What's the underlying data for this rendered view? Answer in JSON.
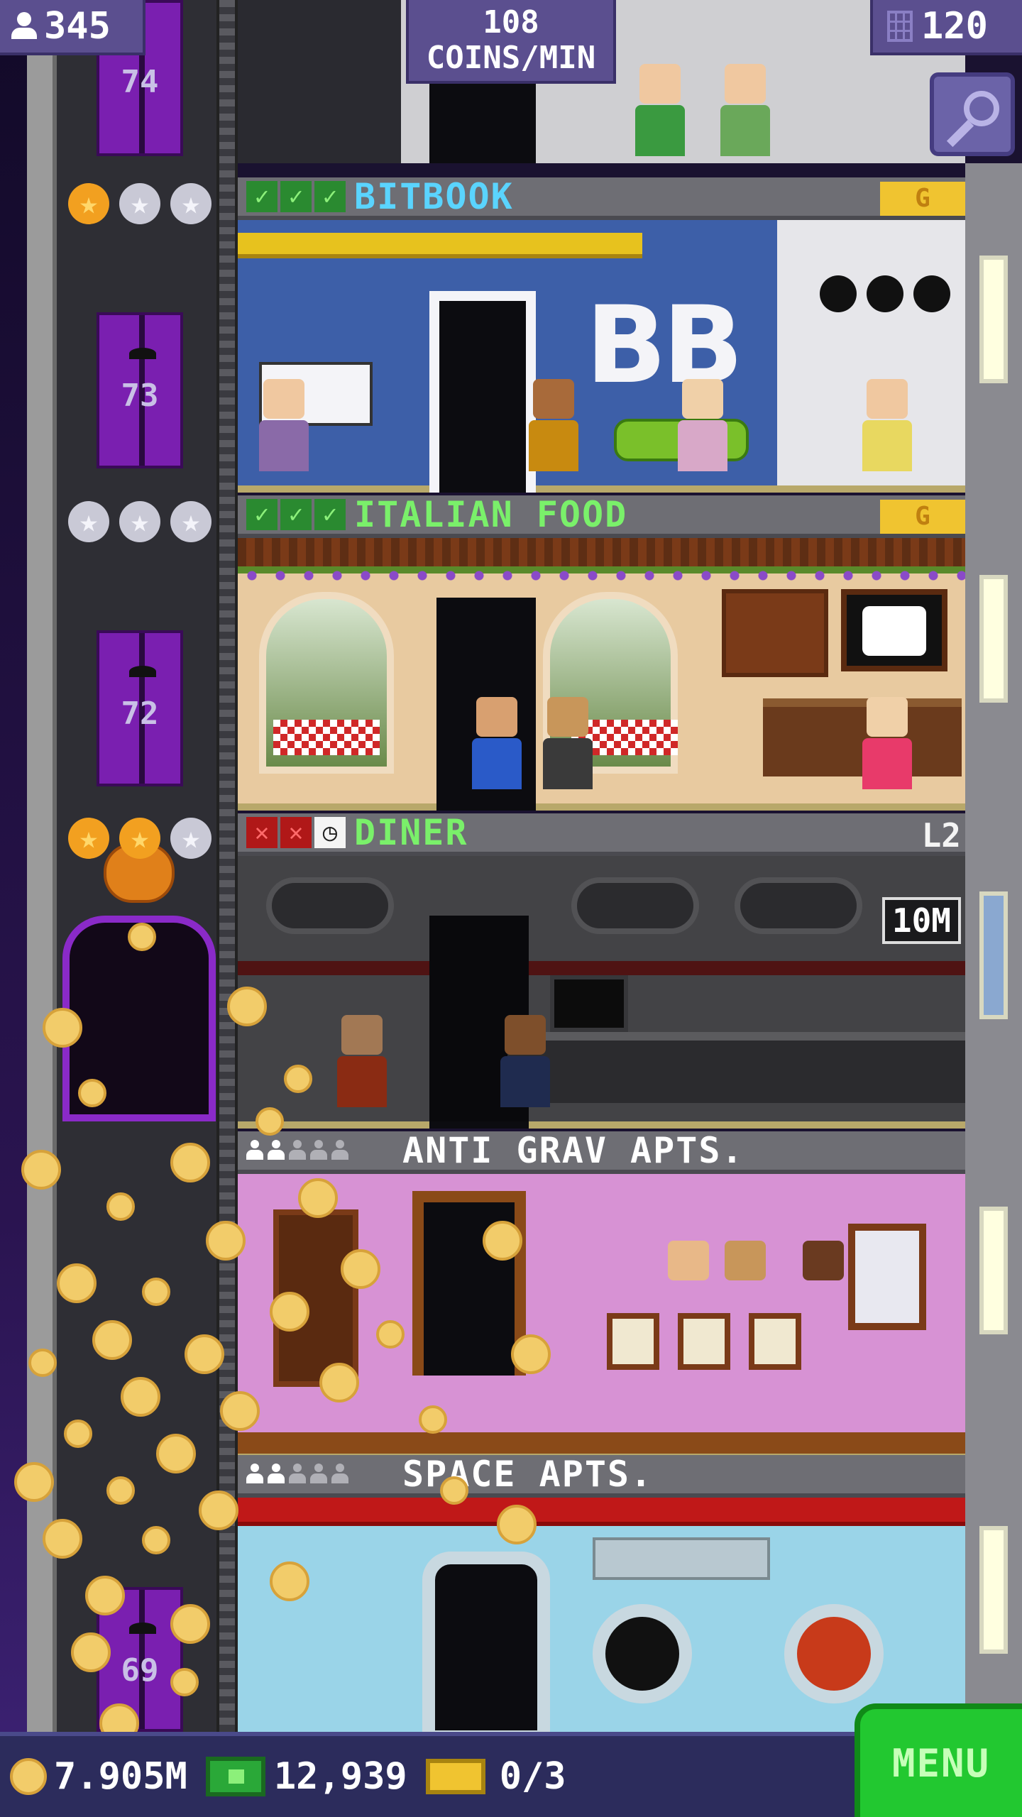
{
  "hud": {
    "population": "345",
    "coin_rate_value": "108",
    "coin_rate_unit": "COINS/MIN",
    "floors": "120"
  },
  "elevator": {
    "floor_numbers": [
      "74",
      "73",
      "72",
      "69"
    ]
  },
  "floors": [
    {
      "name": "BITBOOK",
      "status_icons": [
        "check",
        "check",
        "check"
      ],
      "badge": "G",
      "stars": [
        "gold",
        "silver",
        "silver"
      ]
    },
    {
      "name": "ITALIAN FOOD",
      "status_icons": [
        "check",
        "check",
        "check"
      ],
      "badge": "G",
      "stars": [
        "silver",
        "silver",
        "silver"
      ]
    },
    {
      "name": "DINER",
      "status_icons": [
        "x",
        "x",
        "clock"
      ],
      "level": "L2",
      "timer": "10M",
      "stars": [
        "gold",
        "gold",
        "silver"
      ]
    },
    {
      "name": "ANTI GRAV APTS.",
      "residents": 5,
      "residents_active": 2
    },
    {
      "name": "SPACE APTS.",
      "residents": 5,
      "residents_active": 2
    }
  ],
  "bottom_bar": {
    "coins": "7.905M",
    "bux": "12,939",
    "tickets": "0/3",
    "menu_label": "MENU"
  },
  "colors": {
    "elevator_door": "#7a1fb0",
    "menu_button": "#22c830",
    "hud_pill": "#5b4f8f",
    "coin": "#f2cc6a"
  },
  "icons": {
    "population": "person-icon",
    "floors": "building-icon",
    "zoom": "magnifier-icon",
    "coins": "coin-icon",
    "bux": "bux-icon",
    "tickets": "vip-ticket-icon"
  }
}
